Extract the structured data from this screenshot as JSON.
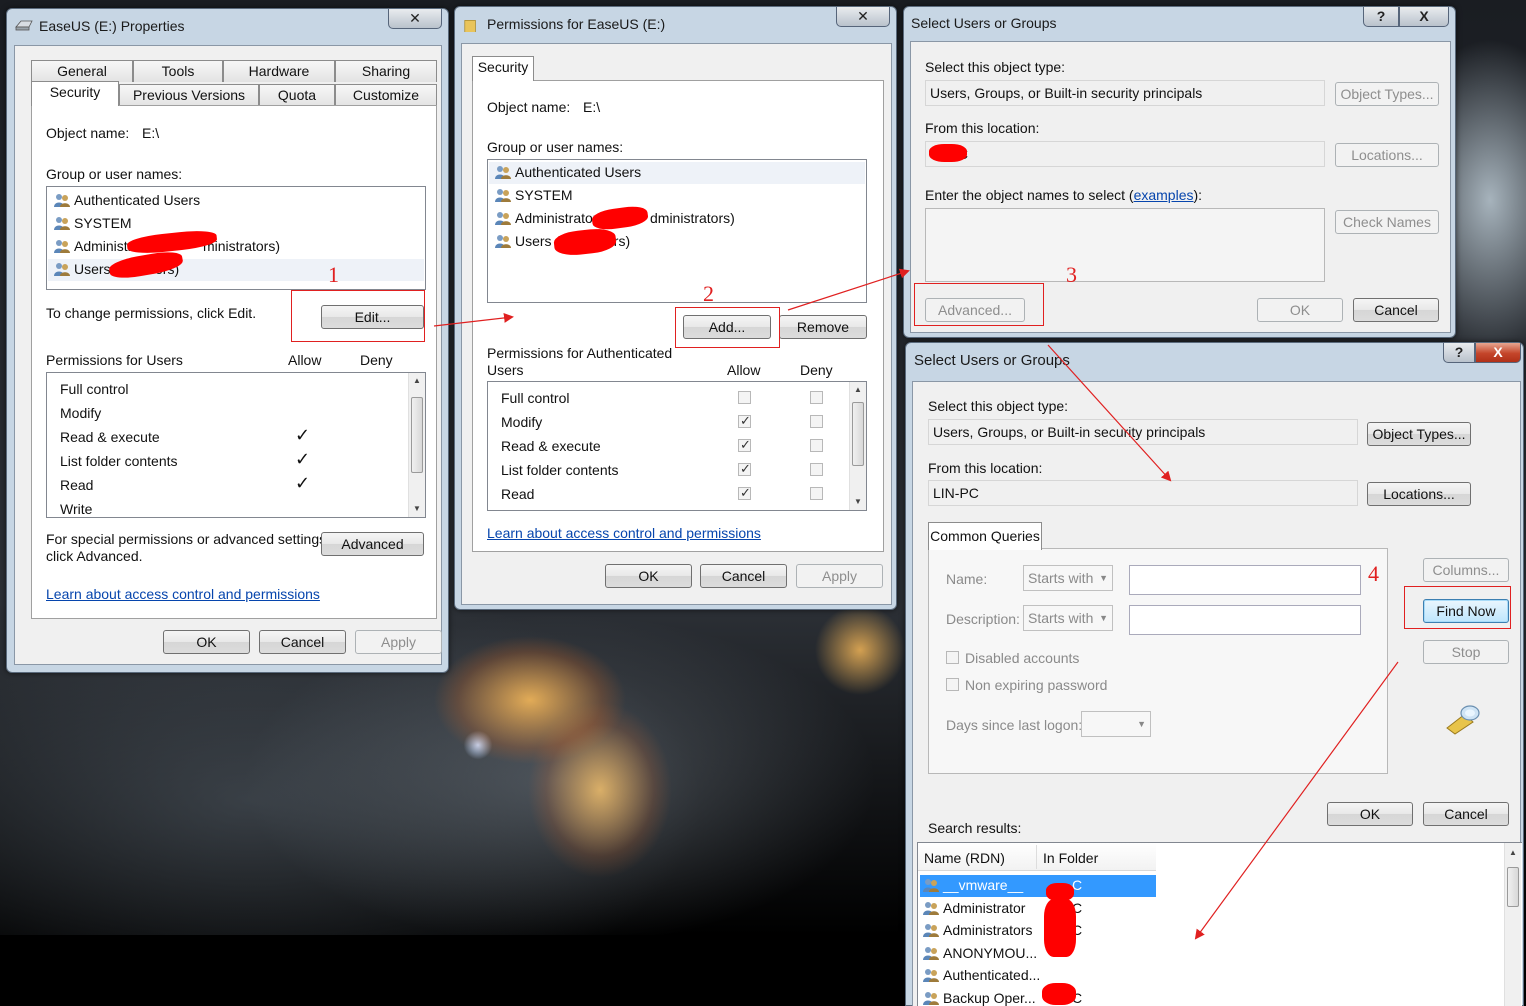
{
  "props": {
    "title": "EaseUS (E:) Properties",
    "tabs_back": [
      "General",
      "Tools",
      "Hardware",
      "Sharing"
    ],
    "tabs_front": [
      "Security",
      "Previous Versions",
      "Quota",
      "Customize"
    ],
    "object_label": "Object name:",
    "object_value": "E:\\",
    "group_label": "Group or user names:",
    "users": [
      "Authenticated Users",
      "SYSTEM",
      "Administra",
      "ministrators)",
      "Users (",
      "sers)"
    ],
    "change_text": "To change permissions, click Edit.",
    "edit_btn": "Edit...",
    "perm_label": "Permissions for Users",
    "allow": "Allow",
    "deny": "Deny",
    "perms": [
      "Full control",
      "Modify",
      "Read & execute",
      "List folder contents",
      "Read",
      "Write"
    ],
    "checked": [
      false,
      false,
      true,
      true,
      true,
      false
    ],
    "special_1": "For special permissions or advanced settings,",
    "special_2": "click Advanced.",
    "advanced_btn": "Advanced",
    "learn_link": "Learn about access control and permissions",
    "ok": "OK",
    "cancel": "Cancel",
    "apply": "Apply"
  },
  "perm_dialog": {
    "title": "Permissions for EaseUS (E:)",
    "tab": "Security",
    "object_label": "Object name:",
    "object_value": "E:\\",
    "group_label": "Group or user names:",
    "users": [
      "Authenticated Users",
      "SYSTEM",
      "Administrators",
      "dministrators)",
      "Users (",
      "ers)"
    ],
    "add_btn": "Add...",
    "remove_btn": "Remove",
    "perm_label_1": "Permissions for Authenticated",
    "perm_label_2": "Users",
    "allow": "Allow",
    "deny": "Deny",
    "perms": [
      "Full control",
      "Modify",
      "Read & execute",
      "List folder contents",
      "Read"
    ],
    "allow_checked": [
      false,
      true,
      true,
      true,
      true
    ],
    "learn_link": "Learn about access control and permissions",
    "ok": "OK",
    "cancel": "Cancel",
    "apply": "Apply"
  },
  "select1": {
    "title": "Select Users or Groups",
    "help": "?",
    "close": "X",
    "type_label": "Select this object type:",
    "type_value": "Users, Groups, or Built-in security principals",
    "type_btn": "Object Types...",
    "loc_label": "From this location:",
    "loc_value": "C",
    "loc_btn": "Locations...",
    "enter_label": "Enter the object names to select (",
    "examples": "examples",
    "enter_label_end": "):",
    "check_btn": "Check Names",
    "advanced_btn": "Advanced...",
    "ok": "OK",
    "cancel": "Cancel"
  },
  "select2": {
    "title": "Select Users or Groups",
    "help": "?",
    "close": "X",
    "type_label": "Select this object type:",
    "type_value": "Users, Groups, or Built-in security principals",
    "type_btn": "Object Types...",
    "loc_label": "From this location:",
    "loc_value": "LIN-PC",
    "loc_btn": "Locations...",
    "tab": "Common Queries",
    "name_label": "Name:",
    "desc_label": "Description:",
    "starts_with": "Starts with",
    "disabled": "Disabled accounts",
    "nonexp": "Non expiring password",
    "days_label": "Days since last logon:",
    "columns_btn": "Columns...",
    "find_btn": "Find Now",
    "stop_btn": "Stop",
    "ok": "OK",
    "cancel": "Cancel",
    "results_label": "Search results:",
    "col_name": "Name (RDN)",
    "col_folder": "In Folder",
    "results": [
      {
        "name": "__vmware__",
        "folder": "C"
      },
      {
        "name": "Administrator",
        "folder": "C"
      },
      {
        "name": "Administrators",
        "folder": "C"
      },
      {
        "name": "ANONYMOU...",
        "folder": ""
      },
      {
        "name": "Authenticated...",
        "folder": ""
      },
      {
        "name": "Backup Oper...",
        "folder": "C"
      }
    ]
  },
  "steps": [
    "1",
    "2",
    "3",
    "4"
  ],
  "colors": {
    "annotation": "#e02020",
    "selection": "#3399ff",
    "link": "#0645ad"
  }
}
